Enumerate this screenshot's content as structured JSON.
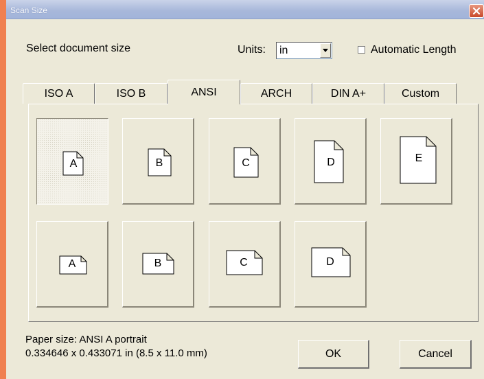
{
  "window": {
    "title": "Scan Size"
  },
  "header": {
    "select_label": "Select document size",
    "units_label": "Units:",
    "units_value": "in",
    "auto_length_label": "Automatic Length",
    "auto_length_checked": false
  },
  "tabs": [
    {
      "label": "ISO A",
      "active": false
    },
    {
      "label": "ISO B",
      "active": false
    },
    {
      "label": "ANSI",
      "active": true
    },
    {
      "label": "ARCH",
      "active": false
    },
    {
      "label": "DIN A+",
      "active": false
    },
    {
      "label": "Custom",
      "active": false
    }
  ],
  "sizes_portrait": [
    {
      "letter": "A",
      "selected": true
    },
    {
      "letter": "B",
      "selected": false
    },
    {
      "letter": "C",
      "selected": false
    },
    {
      "letter": "D",
      "selected": false
    },
    {
      "letter": "E",
      "selected": false
    }
  ],
  "sizes_landscape": [
    {
      "letter": "A"
    },
    {
      "letter": "B"
    },
    {
      "letter": "C"
    },
    {
      "letter": "D"
    }
  ],
  "footer": {
    "paper_size_line": "Paper size:  ANSI A portrait",
    "dimensions_line": "0.334646 x 0.433071 in  (8.5 x 11.0 mm)",
    "ok_label": "OK",
    "cancel_label": "Cancel"
  },
  "colors": {
    "background": "#f08050",
    "dialog": "#ece9d8",
    "titlebar": "#a7b7da",
    "close_button": "#c8482a"
  }
}
